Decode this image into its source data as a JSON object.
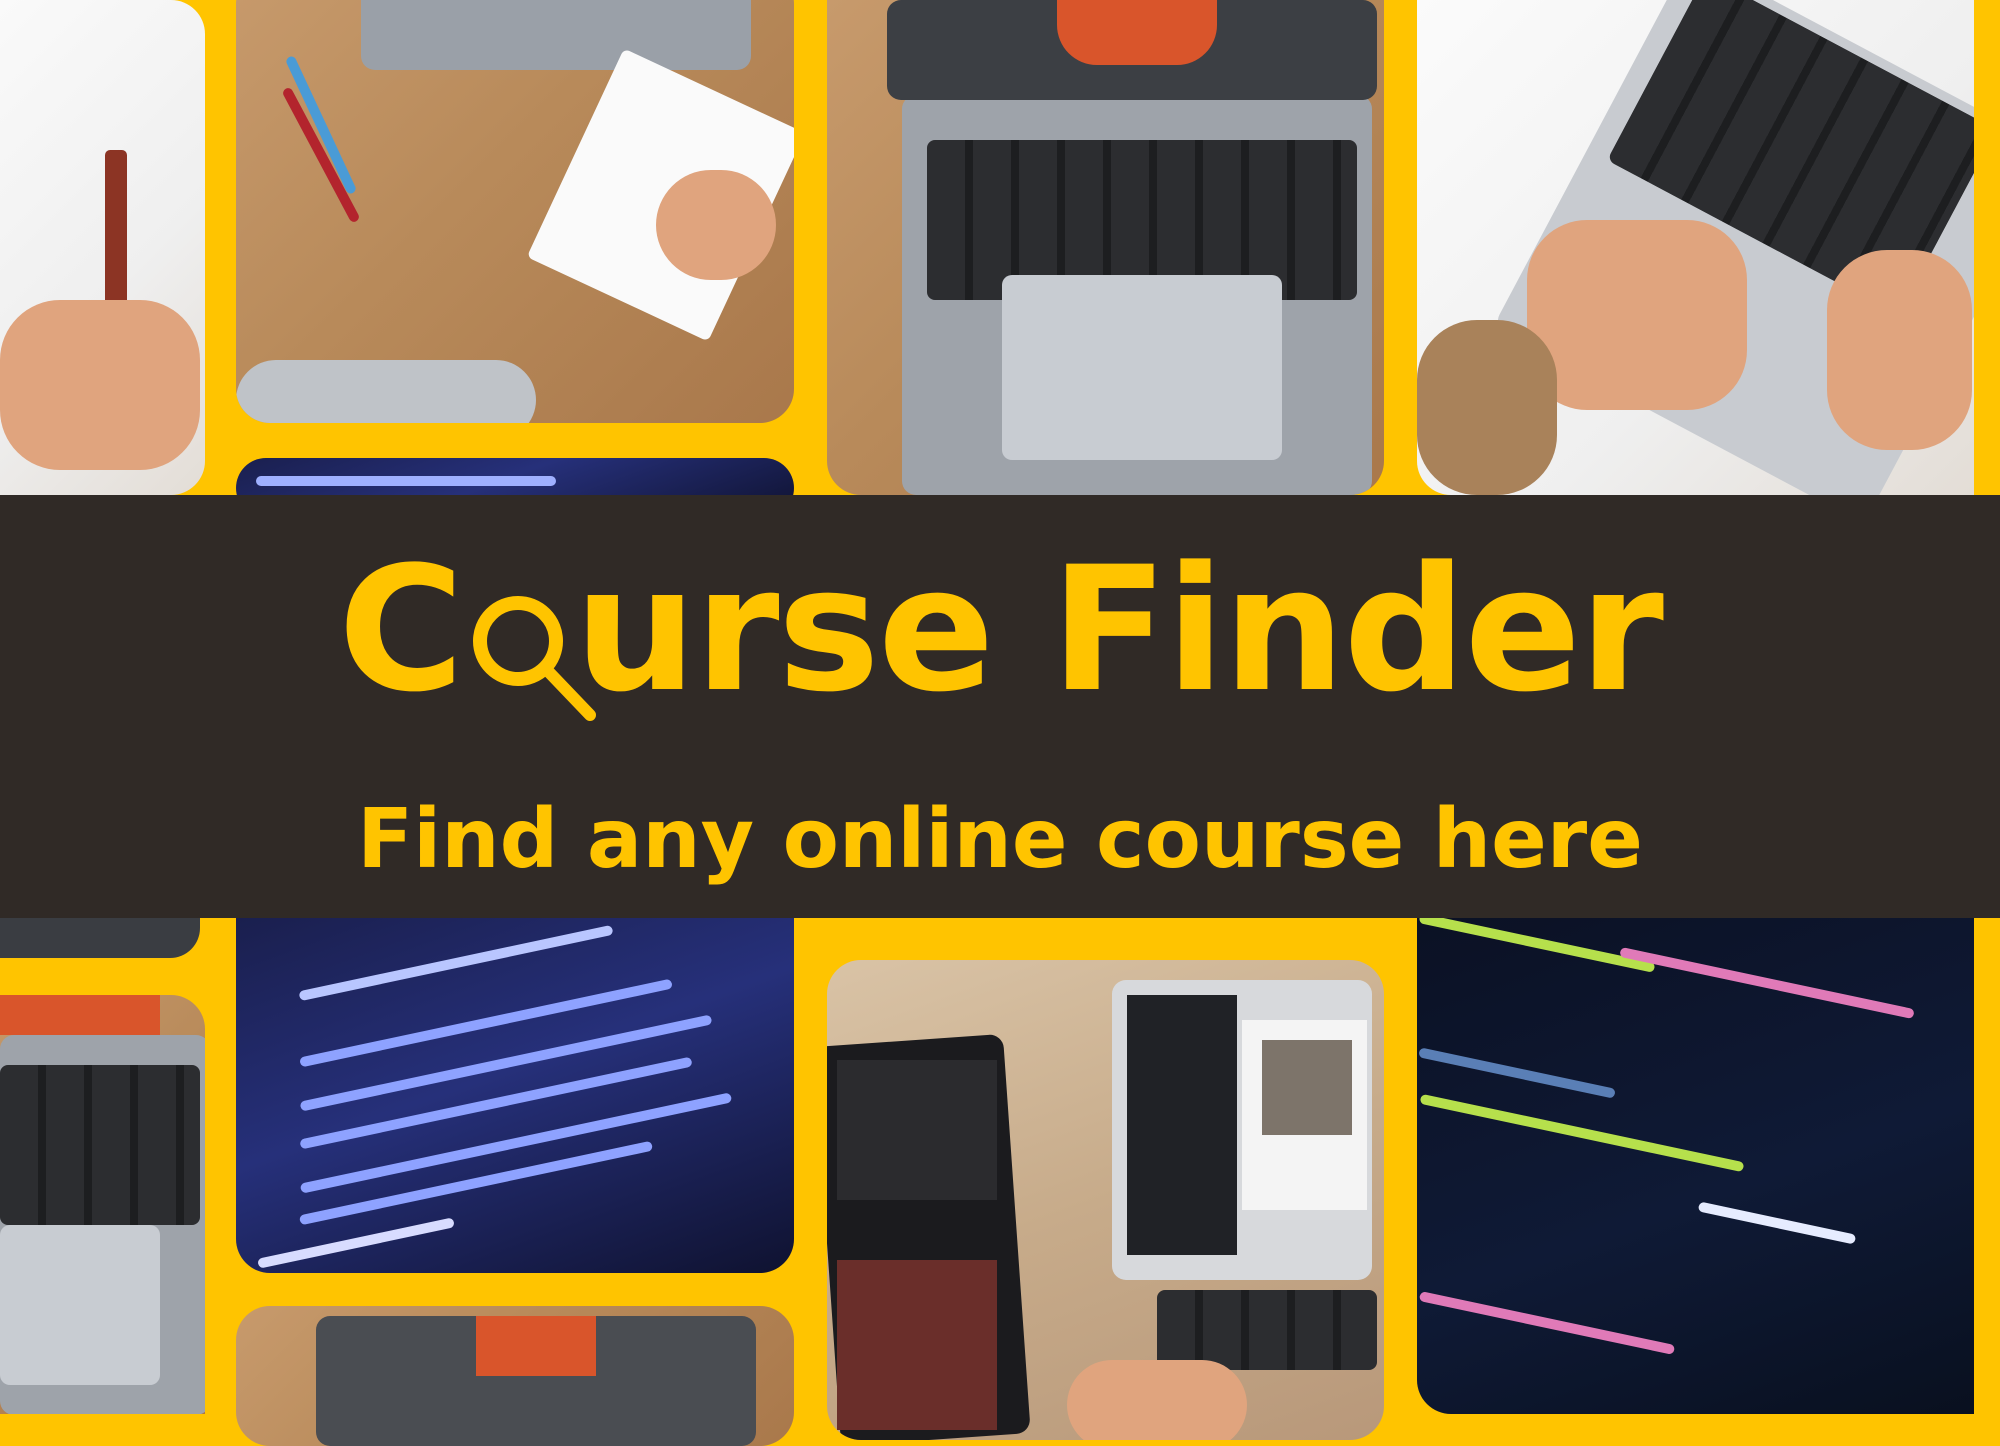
{
  "banner": {
    "title_prefix": "C",
    "title_rest": "urse Finder",
    "subtitle": "Find any online course here"
  },
  "icons": {
    "title_o": "magnifying-glass-icon"
  },
  "colors": {
    "background": "#ffc400",
    "banner": "#302a26",
    "text": "#ffc400"
  }
}
